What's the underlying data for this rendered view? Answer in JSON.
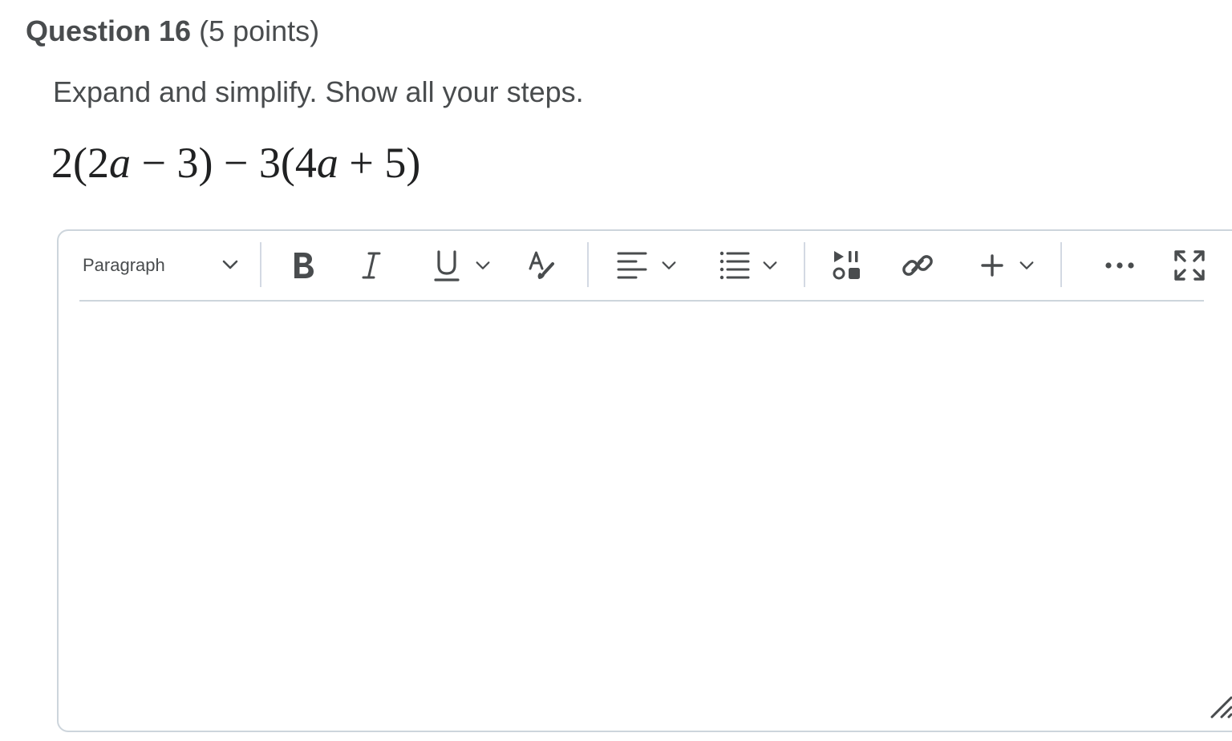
{
  "question": {
    "title": "Question 16",
    "points": "(5 points)",
    "prompt": "Expand and simplify.  Show all your steps.",
    "expression": {
      "p1": "2(2",
      "v1": "a",
      "p2": " − 3) − 3(4",
      "v2": "a",
      "p3": " + 5)"
    }
  },
  "editor": {
    "format_select": {
      "value": "Paragraph"
    },
    "icons": {
      "format_chevron": "chevron-down-icon",
      "bold": "bold-icon",
      "italic": "italic-icon",
      "underline": "underline-icon",
      "underline_dropdown": "chevron-down-icon",
      "format_painter": "format-painter-icon",
      "align": "align-left-icon",
      "align_dropdown": "chevron-down-icon",
      "list": "bulleted-list-icon",
      "list_dropdown": "chevron-down-icon",
      "media": "insert-media-icon",
      "link": "link-icon",
      "insert": "plus-icon",
      "insert_dropdown": "chevron-down-icon",
      "more": "more-ellipsis-icon",
      "fullscreen": "fullscreen-icon",
      "resize": "resize-grip-icon"
    },
    "content": ""
  },
  "colors": {
    "text": "#494c4e",
    "border": "#cdd5dc",
    "icon": "#494c4e"
  }
}
